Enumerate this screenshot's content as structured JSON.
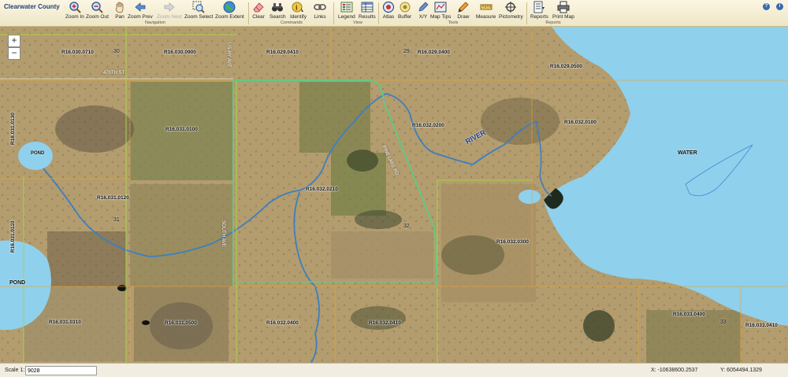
{
  "app": {
    "title": "Clearwater County"
  },
  "toolbar": {
    "groups": {
      "navigation": "Navigation",
      "commands": "Commands",
      "view": "View",
      "tools": "Tools",
      "reports": "Reports"
    },
    "zoom_in": "Zoom In",
    "zoom_out": "Zoom Out",
    "pan": "Pan",
    "zoom_prev": "Zoom Prev",
    "zoom_next": "Zoom Next",
    "zoom_select": "Zoom Select",
    "zoom_extent": "Zoom Extent",
    "clear": "Clear",
    "search": "Search",
    "identify": "Identify",
    "links": "Links",
    "legend": "Legend",
    "results": "Results",
    "atlas": "Atlas",
    "buffer": "Buffer",
    "xy": "X/Y",
    "map_tips": "Map Tips",
    "draw": "Draw",
    "measure": "Measure",
    "pictometry": "Pictometry",
    "reports": "Reports",
    "print_map": "Print Map",
    "help1": "?",
    "help2": "i"
  },
  "map": {
    "zoom_in_symbol": "+",
    "zoom_out_symbol": "−",
    "parcels": [
      "R16.030.0710",
      "R16.030.0900",
      "R16.029.0410",
      "R16.029.0400",
      "R16.029.0500",
      "R16.031.0100",
      "R16.032.0200",
      "R16.032.0100",
      "R16.031.0130",
      "R16.031.0120",
      "R16.032.0210",
      "R16.031.0110",
      "R16.032.0300",
      "R16.031.0310",
      "R16.031.0500",
      "R16.032.0400",
      "R16.032.0410",
      "R16.033.0400",
      "R16.033.0410"
    ],
    "sections": [
      "30",
      "29",
      "31",
      "32",
      "33"
    ],
    "roads": [
      "470TH ST",
      "US-HY AVE",
      "PINE LAKE RD",
      "SOUTH AVE"
    ],
    "water_labels": [
      "POND",
      "POND",
      "WATER",
      "RIVER"
    ]
  },
  "status": {
    "scale_label": "Scale 1:",
    "scale_value": "9028",
    "x": "X: -10638600.2537",
    "y": "Y: 6054494.1329"
  }
}
